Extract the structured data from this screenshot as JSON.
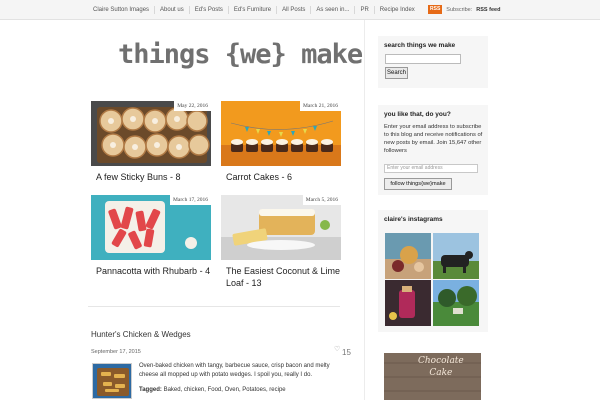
{
  "nav": {
    "items": [
      "Claire Sutton Images",
      "About us",
      "Ed's Posts",
      "Ed's Furniture",
      "All Posts",
      "As seen in...",
      "PR",
      "Recipe Index"
    ],
    "rss_badge": "RSS",
    "rss_subscribe": "Subscribe:",
    "rss_feed": "RSS feed"
  },
  "logo": "things {we} make",
  "posts": [
    {
      "date": "May 22, 2016",
      "title": "A few Sticky Buns - 8"
    },
    {
      "date": "March 21, 2016",
      "title": "Carrot Cakes - 6"
    },
    {
      "date": "March 17, 2016",
      "title": "Pannacotta with Rhubarb - 4"
    },
    {
      "date": "March 5, 2016",
      "title": "The Easiest Coconut & Lime Loaf - 13"
    }
  ],
  "article": {
    "title": "Hunter's Chicken & Wedges",
    "date": "September 17, 2015",
    "likes": "15",
    "excerpt": "Oven-baked chicken with tangy, barbecue sauce, crisp bacon and melty cheese all mopped up with potato wedges. I spoil you, really I do.",
    "tags_label": "Tagged:",
    "tags": "Baked, chicken, Food, Oven, Potatoes, recipe"
  },
  "sidebar": {
    "search_title": "search things we make",
    "search_button": "Search",
    "follow_title": "you like that, do you?",
    "follow_text": "Enter your email address to subscribe to this blog and receive notifications of new posts by email. Join 15,647 other followers",
    "email_placeholder": "Enter your email address",
    "follow_button": "follow things{we}make",
    "instagram_title": "claire's instagrams",
    "cake_line1": "Chocolate",
    "cake_line2": "Cake"
  },
  "colors": {
    "rss": "#e66a17",
    "logo": "#707070"
  }
}
